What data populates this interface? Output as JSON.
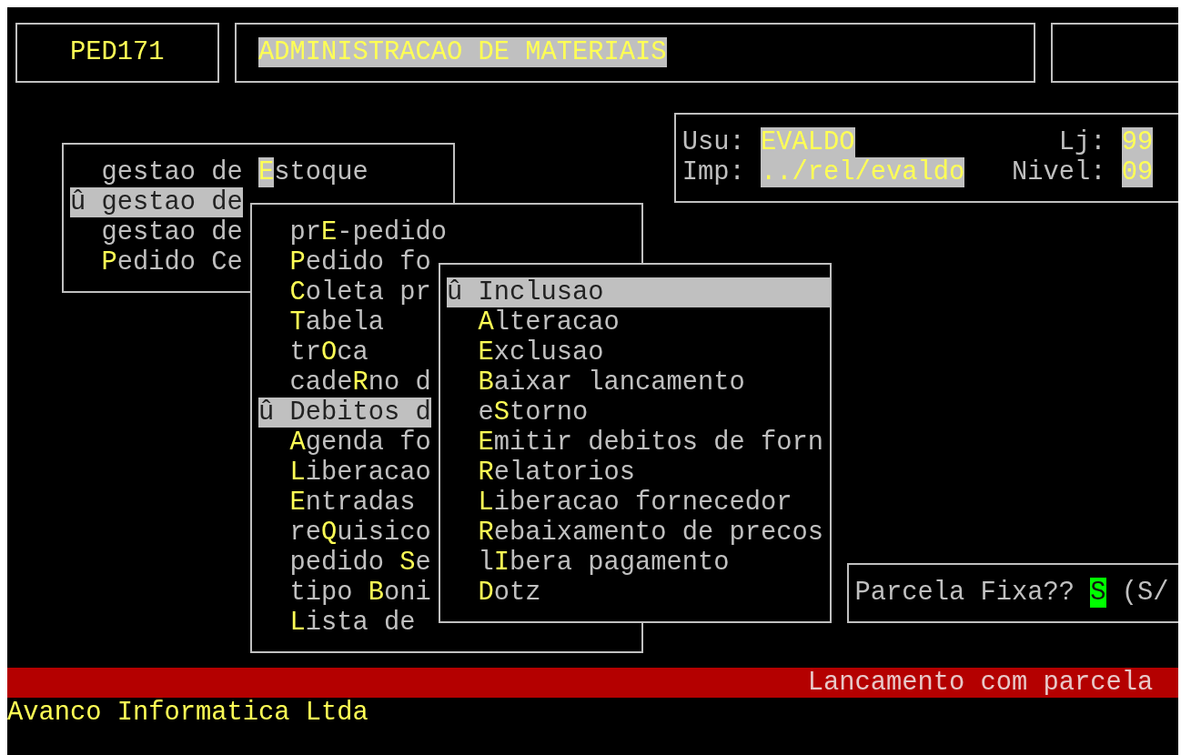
{
  "header": {
    "program_code": "PED171",
    "title": "ADMINISTRACAO DE MATERIAIS"
  },
  "session": {
    "user_label": "Usu:",
    "user": "EVALDO",
    "store_label": "Lj:",
    "store": "99",
    "printer_label": "Imp:",
    "printer": "../rel/evaldo",
    "access_label": "Nivel:",
    "access": "09"
  },
  "menus": [
    {
      "selection_marker": "û",
      "items": [
        {
          "label": "gestao de **E**stoque",
          "selected": false,
          "hotkey_cursor": true
        },
        {
          "label": "gestao de",
          "selected": true
        },
        {
          "label": "gestao de",
          "selected": false
        },
        {
          "label": "**P**edido Ce",
          "selected": false,
          "hotkey_cursor": false
        }
      ]
    },
    {
      "selection_marker": "û",
      "items": [
        {
          "label": "pr**E**-pedido",
          "selected": false
        },
        {
          "label": "**P**edido fo",
          "selected": false
        },
        {
          "label": "**C**oleta pr",
          "selected": false
        },
        {
          "label": "**T**abela",
          "selected": false
        },
        {
          "label": "tr**O**ca",
          "selected": false
        },
        {
          "label": "cade**R**no d",
          "selected": false
        },
        {
          "label": "Debitos d",
          "selected": true
        },
        {
          "label": "**A**genda fo",
          "selected": false
        },
        {
          "label": "**L**iberacao",
          "selected": false
        },
        {
          "label": "**E**ntradas",
          "selected": false
        },
        {
          "label": "re**Q**uisico",
          "selected": false
        },
        {
          "label": "pedido **S**e",
          "selected": false
        },
        {
          "label": "tipo **B**oni",
          "selected": false
        },
        {
          "label": "**L**ista de",
          "selected": false
        }
      ]
    },
    {
      "selection_marker": "û",
      "items": [
        {
          "label": "Inclusao",
          "selected": true
        },
        {
          "label": "**A**lteracao",
          "selected": false
        },
        {
          "label": "**E**xclusao",
          "selected": false
        },
        {
          "label": "**B**aixar lancamento",
          "selected": false
        },
        {
          "label": "e**S**torno",
          "selected": false
        },
        {
          "label": "**E**mitir debitos de forn",
          "selected": false
        },
        {
          "label": "**R**elatorios",
          "selected": false
        },
        {
          "label": "**L**iberacao fornecedor",
          "selected": false
        },
        {
          "label": "**R**ebaixamento de precos",
          "selected": false
        },
        {
          "label": "l**I**bera pagamento",
          "selected": false
        },
        {
          "label": "**D**otz",
          "selected": false
        }
      ]
    }
  ],
  "prompt": {
    "question": "Parcela Fixa??",
    "value": "S",
    "options": "(S/"
  },
  "status_bar": {
    "message": "Lancamento com parcela"
  },
  "footer": {
    "company": "Avanco Informatica Ltda"
  }
}
